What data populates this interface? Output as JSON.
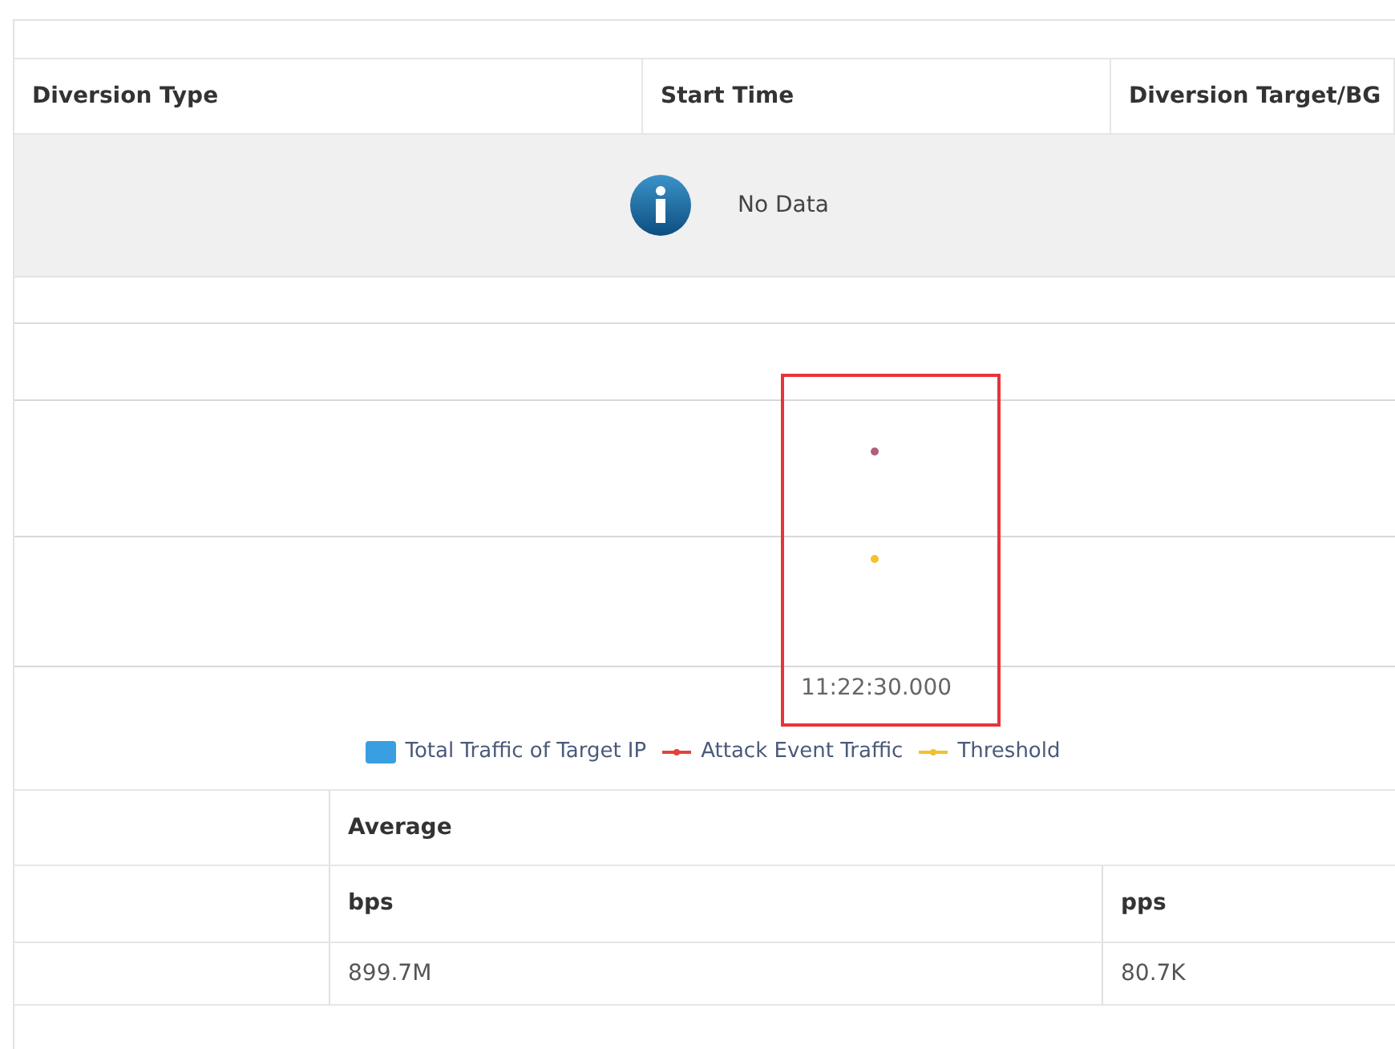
{
  "diversion_table": {
    "columns": [
      "Diversion Type",
      "Start Time",
      "Diversion Target/BG"
    ],
    "empty_message": "No Data"
  },
  "chart": {
    "x_label": "11:22:30.000",
    "legend": [
      {
        "label": "Total Traffic of Target IP",
        "kind": "box",
        "color": "#3a9fe0"
      },
      {
        "label": "Attack Event Traffic",
        "kind": "line",
        "color": "#e0443c"
      },
      {
        "label": "Threshold",
        "kind": "line",
        "color": "#f2c12e"
      }
    ]
  },
  "stats_table": {
    "group": "Average",
    "columns": [
      "bps",
      "pps"
    ],
    "values": [
      "899.7M",
      "80.7K"
    ]
  }
}
